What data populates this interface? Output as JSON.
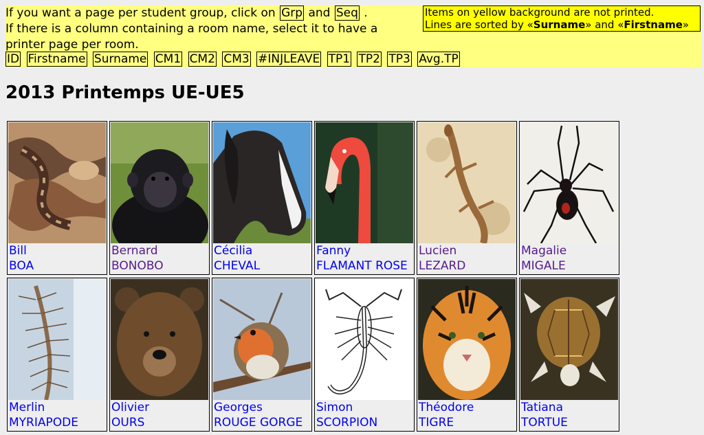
{
  "header": {
    "intro_line1_pre": "If you want a page per student group, click on",
    "grp_label": "Grp",
    "and_word": "and",
    "seq_label": "Seq",
    "intro_line1_post": ".",
    "intro_line2": "If there is a column containing a room name, select it to have a printer page per room.",
    "notice_line1": "Items on yellow background are not printed.",
    "notice_line2_pre": "Lines are sorted by «",
    "notice_key1": "Surname",
    "notice_mid": "» and «",
    "notice_key2": "Firstname",
    "notice_post": "»",
    "columns": [
      "ID",
      "Firstname",
      "Surname",
      "CM1",
      "CM2",
      "CM3",
      "#INJLEAVE",
      "TP1",
      "TP2",
      "TP3",
      "Avg.TP"
    ]
  },
  "title": "2013 Printemps UE-UE5",
  "students": [
    {
      "firstname": "Bill",
      "surname": "BOA",
      "photo_icon": "boa-photo",
      "visited": false
    },
    {
      "firstname": "Bernard",
      "surname": "BONOBO",
      "photo_icon": "bonobo-photo",
      "visited": true
    },
    {
      "firstname": "Cécilia",
      "surname": "CHEVAL",
      "photo_icon": "horse-photo",
      "visited": false
    },
    {
      "firstname": "Fanny",
      "surname": "FLAMANT ROSE",
      "photo_icon": "flamingo-photo",
      "visited": false
    },
    {
      "firstname": "Lucien",
      "surname": "LEZARD",
      "photo_icon": "lizard-photo",
      "visited": true
    },
    {
      "firstname": "Magalie",
      "surname": "MIGALE",
      "photo_icon": "spider-photo",
      "visited": true
    },
    {
      "firstname": "Merlin",
      "surname": "MYRIAPODE",
      "photo_icon": "centipede-photo",
      "visited": false
    },
    {
      "firstname": "Olivier",
      "surname": "OURS",
      "photo_icon": "bear-photo",
      "visited": false
    },
    {
      "firstname": "Georges",
      "surname": "ROUGE GORGE",
      "photo_icon": "robin-photo",
      "visited": false
    },
    {
      "firstname": "Simon",
      "surname": "SCORPION",
      "photo_icon": "scorpion-photo",
      "visited": false
    },
    {
      "firstname": "Théodore",
      "surname": "TIGRE",
      "photo_icon": "tiger-photo",
      "visited": false
    },
    {
      "firstname": "Tatiana",
      "surname": "TORTUE",
      "photo_icon": "turtle-photo",
      "visited": false
    }
  ],
  "colors": {
    "yellow_bar": "#ffff80",
    "notice_bg": "#ffff00",
    "link": "#0000ee",
    "visited_link": "#551a8b",
    "page_bg": "#eeeeee"
  }
}
